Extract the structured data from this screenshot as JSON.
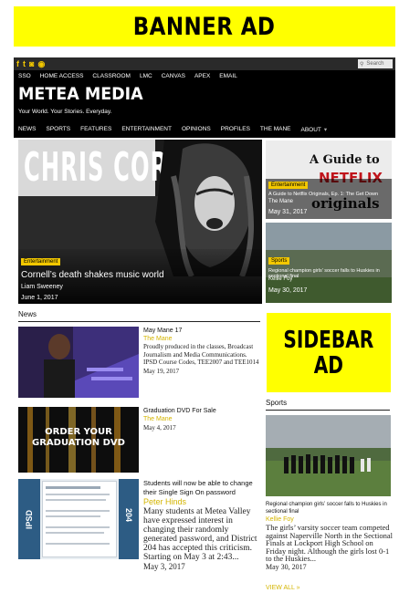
{
  "banner_ad": {
    "label": "BANNER AD"
  },
  "header": {
    "social_icons": [
      "f",
      "t",
      "ig",
      "rss"
    ],
    "search_placeholder": "Search",
    "top_nav": [
      "SSO",
      "HOME ACCESS",
      "CLASSROOM",
      "LMC",
      "CANVAS",
      "APEX",
      "EMAIL"
    ],
    "site_title": "METEA MEDIA",
    "tagline": "Your World. Your Stories. Everyday.",
    "main_nav": [
      "NEWS",
      "SPORTS",
      "FEATURES",
      "ENTERTAINMENT",
      "OPINIONS",
      "PROFILES",
      "THE MANE",
      "ABOUT"
    ]
  },
  "hero": {
    "art_title": "CHRIS CORNELL",
    "category": "Entertainment",
    "headline": "Cornell’s death shakes music world",
    "author": "Liam Sweeney",
    "date": "June 1, 2017"
  },
  "side_cards": [
    {
      "art_line1": "A Guide to",
      "art_line2": "NETFLIX",
      "art_line3": "originals",
      "category": "Entertainment",
      "headline": "A Guide to Netflix Originals, Ep. 1: The Get Down",
      "author": "The Mane",
      "date": "May 31, 2017"
    },
    {
      "category": "Sports",
      "headline": "Regional champion girls’ soccer falls to Huskies in sectional final",
      "author": "Kellie Foy",
      "date": "May 30, 2017"
    }
  ],
  "news": {
    "section_title": "News",
    "items": [
      {
        "title": "May Mane 17",
        "author": "The Mane",
        "excerpt": "Proudly produced in the classes, Broadcast Journalism and Media Communications. IPSD Course Codes, TEE2007 and TEE1014",
        "date": "May 19, 2017"
      },
      {
        "title": "Graduation DVD For Sale",
        "author": "The Mane",
        "excerpt": "",
        "date": "May 4, 2017",
        "thumb_line1": "ORDER YOUR",
        "thumb_line2": "GRADUATION DVD"
      },
      {
        "title": "Students will now be able to change their Single Sign On password",
        "author": "Peter Hinds",
        "excerpt": "Many students at Metea Valley have expressed interest in changing their randomly generated password, and District 204 has accepted this criticism. Starting on May 3 at 2:43...",
        "date": "May 3, 2017",
        "thumb_left": "IPSD",
        "thumb_right": "204"
      }
    ]
  },
  "sidebar_ad": {
    "line1": "SIDEBAR",
    "line2": "AD"
  },
  "sports": {
    "section_title": "Sports",
    "title": "Regional champion girls’ soccer falls to Huskies in sectional final",
    "author": "Kellie Foy",
    "excerpt": "The girls’ varsity soccer team competed against Naperville North in the Sectional Finals at Lockport High School on Friday night. Although the girls lost 0-1 to the Huskies...",
    "date": "May 30, 2017",
    "view_all": "VIEW ALL »"
  },
  "colors": {
    "accent_yellow": "#f3c800",
    "ad_yellow": "#ffff00",
    "author_gold": "#d4b500",
    "header_black": "#000000"
  }
}
